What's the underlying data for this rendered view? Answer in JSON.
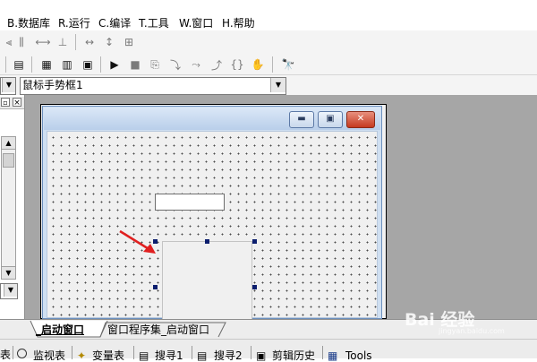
{
  "menu": {
    "items": [
      {
        "label": "B.数据库"
      },
      {
        "label": "R.运行"
      },
      {
        "label": "C.编译"
      },
      {
        "label": "T.工具"
      },
      {
        "label": "W.窗口"
      },
      {
        "label": "H.帮助"
      }
    ]
  },
  "selector": {
    "value": "鼠标手势框1"
  },
  "editor_tabs": {
    "active": "_启动窗口",
    "other": "窗口程序集_启动窗口"
  },
  "bottom_tabs": [
    {
      "label": "监视表"
    },
    {
      "label": "变量表"
    },
    {
      "label": "搜寻1"
    },
    {
      "label": "搜寻2"
    },
    {
      "label": "剪辑历史"
    },
    {
      "label": "Tools"
    }
  ],
  "watermark": {
    "text": "Bai 经验",
    "subtext": "jingyan.baidu.com"
  },
  "colors": {
    "arrow": "#e02020",
    "selection_handle": "#0c1e6e"
  }
}
